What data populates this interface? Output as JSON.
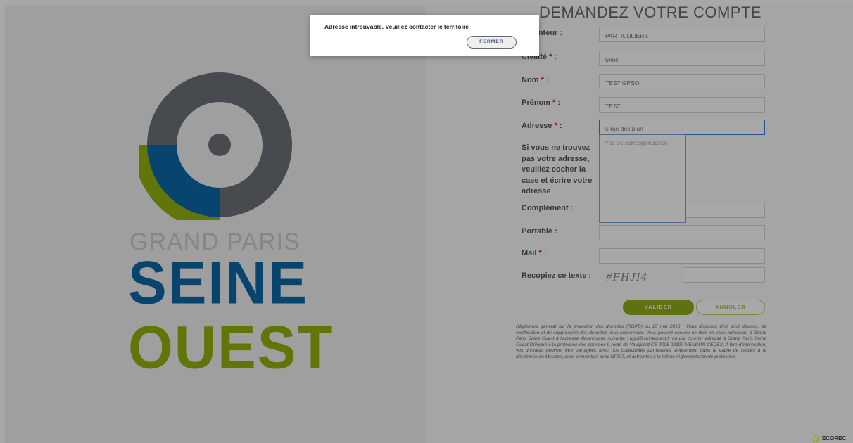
{
  "logo": {
    "line1": "GRAND PARIS",
    "line2": "SEINE",
    "line3": "OUEST"
  },
  "form": {
    "title": "DEMANDEZ VOTRE COMPTE",
    "required_mark": "*",
    "fields": {
      "detenteur": {
        "label": "Détenteur :",
        "value": "PARTICULIERS"
      },
      "civilite": {
        "label": "Civilité",
        "label_suffix": ":",
        "value": "Mme"
      },
      "nom": {
        "label": "Nom",
        "label_suffix": ":",
        "value": "TEST GPSO"
      },
      "prenom": {
        "label": "Prénom",
        "label_suffix": ":",
        "value": "TEST"
      },
      "adresse": {
        "label": "Adresse",
        "label_suffix": ":",
        "value": "5 rue des plan"
      },
      "complement": {
        "label": "Complément :",
        "value": ""
      },
      "portable": {
        "label": "Portable :",
        "value": ""
      },
      "mail": {
        "label": "Mail",
        "label_suffix": ":",
        "value": ""
      },
      "captcha": {
        "label": "Recopiez ce texte :",
        "code": "#FHJI4",
        "value": ""
      }
    },
    "address_hint": "Si vous ne trouvez pas votre adresse, veuillez cocher la case et écrire votre adresse",
    "autocomplete_empty": "Pas de correspondance",
    "buttons": {
      "submit": "VALIDER",
      "cancel": "ANNULER"
    },
    "legal": "Règlement général sur la protection des données (RGPD) du 25 mai 2018 : Vous disposez d'un droit d'accès, de rectification et de suppression des données vous concernant. Vous pouvez exercer ce droit en vous adressant à Grand Paris Seine Ouest à l'adresse électronique suivante : rgpd@seineouest.fr ou par courrier adressé à Grand Paris Seine Ouest Délégué à la protection des données 9 route de Vaugirard CS 9008 92197 MEUDON CEDEX. A titre d'information, vos données peuvent être partagées avec nos collectivités partenaires uniquement dans le cadre de l'accès à la déchèterie de Meudon, sous convention avec GPSO, et astreintes à la même réglementation de protection."
  },
  "dialog": {
    "message": "Adresse introuvable. Veuillez contacter le territoire",
    "close_button": "FERMER"
  },
  "footer": {
    "brand": "ECOREC"
  },
  "colors": {
    "brand_blue": "#0d6aa8",
    "brand_green": "#94b30e",
    "brand_gray": "#6d7177",
    "required": "#e2001a",
    "submit_button": "#8fad1a"
  }
}
